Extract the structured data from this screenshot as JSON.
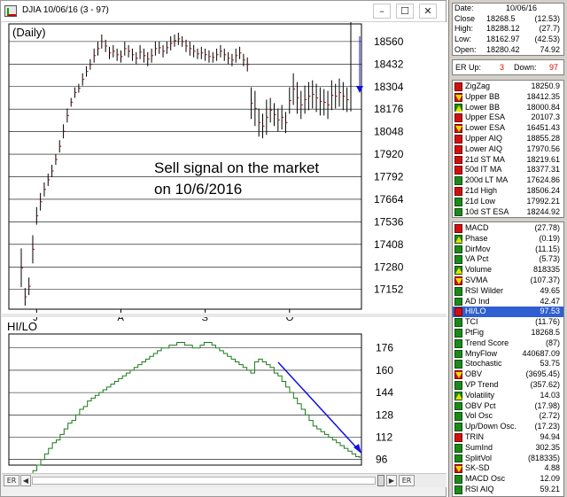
{
  "window": {
    "title": "DJIA 10/06/16 (3 - 97)",
    "minimize": "–",
    "maximize": "☐",
    "close": "✕"
  },
  "price_chart": {
    "period_label": "(Daily)",
    "annotation_line1": "Sell signal on the market",
    "annotation_line2": "on 10/6/2016",
    "y_ticks": [
      "18560",
      "18432",
      "18304",
      "18176",
      "18048",
      "17920",
      "17792",
      "17664",
      "17536",
      "17408",
      "17280",
      "17152"
    ],
    "x_ticks": [
      "J",
      "A",
      "S",
      "O"
    ],
    "bars": [
      [
        17385,
        17165
      ],
      [
        17160,
        17060
      ],
      [
        17220,
        17120
      ],
      [
        17460,
        17300
      ],
      [
        17620,
        17520
      ],
      [
        17700,
        17600
      ],
      [
        17760,
        17680
      ],
      [
        17810,
        17740
      ],
      [
        17860,
        17790
      ],
      [
        17920,
        17860
      ],
      [
        18000,
        17930
      ],
      [
        18090,
        18010
      ],
      [
        18180,
        18100
      ],
      [
        18240,
        18190
      ],
      [
        18300,
        18240
      ],
      [
        18320,
        18270
      ],
      [
        18380,
        18310
      ],
      [
        18420,
        18360
      ],
      [
        18460,
        18400
      ],
      [
        18520,
        18440
      ],
      [
        18560,
        18480
      ],
      [
        18600,
        18520
      ],
      [
        18570,
        18500
      ],
      [
        18530,
        18460
      ],
      [
        18540,
        18470
      ],
      [
        18520,
        18450
      ],
      [
        18510,
        18440
      ],
      [
        18560,
        18480
      ],
      [
        18540,
        18470
      ],
      [
        18520,
        18450
      ],
      [
        18500,
        18430
      ],
      [
        18540,
        18460
      ],
      [
        18520,
        18440
      ],
      [
        18500,
        18420
      ],
      [
        18520,
        18440
      ],
      [
        18560,
        18480
      ],
      [
        18560,
        18490
      ],
      [
        18540,
        18470
      ],
      [
        18560,
        18490
      ],
      [
        18590,
        18510
      ],
      [
        18600,
        18530
      ],
      [
        18610,
        18540
      ],
      [
        18590,
        18530
      ],
      [
        18570,
        18500
      ],
      [
        18560,
        18480
      ],
      [
        18540,
        18470
      ],
      [
        18520,
        18460
      ],
      [
        18530,
        18460
      ],
      [
        18520,
        18450
      ],
      [
        18510,
        18440
      ],
      [
        18500,
        18440
      ],
      [
        18520,
        18450
      ],
      [
        18540,
        18470
      ],
      [
        18520,
        18450
      ],
      [
        18500,
        18430
      ],
      [
        18490,
        18420
      ],
      [
        18520,
        18440
      ],
      [
        18530,
        18460
      ],
      [
        18490,
        18420
      ],
      [
        18470,
        18390
      ],
      [
        18300,
        18120
      ],
      [
        18280,
        18080
      ],
      [
        18180,
        18020
      ],
      [
        18150,
        18010
      ],
      [
        18230,
        18030
      ],
      [
        18240,
        18100
      ],
      [
        18210,
        18080
      ],
      [
        18180,
        18050
      ],
      [
        18200,
        18060
      ],
      [
        18160,
        18040
      ],
      [
        18300,
        18150
      ],
      [
        18380,
        18200
      ],
      [
        18330,
        18150
      ],
      [
        18280,
        18120
      ],
      [
        18310,
        18150
      ],
      [
        18330,
        18170
      ],
      [
        18340,
        18180
      ],
      [
        18320,
        18160
      ],
      [
        18300,
        18140
      ],
      [
        18290,
        18140
      ],
      [
        18280,
        18120
      ],
      [
        18340,
        18170
      ],
      [
        18320,
        18180
      ],
      [
        18350,
        18190
      ],
      [
        18330,
        18170
      ],
      [
        18300,
        18160
      ]
    ],
    "signal_bar": [
      18680,
      18163
    ],
    "annotation_color": "#0000ff"
  },
  "hilo_chart": {
    "title": "HI/LO",
    "y_ticks": [
      "176",
      "160",
      "144",
      "128",
      "112",
      "96"
    ],
    "series": [
      84,
      84,
      86,
      88,
      92,
      96,
      100,
      104,
      108,
      110,
      114,
      118,
      122,
      124,
      128,
      132,
      134,
      138,
      140,
      142,
      144,
      146,
      148,
      150,
      152,
      154,
      156,
      158,
      160,
      162,
      164,
      166,
      168,
      170,
      172,
      174,
      176,
      176,
      178,
      178,
      180,
      180,
      178,
      178,
      176,
      176,
      178,
      180,
      180,
      178,
      176,
      174,
      172,
      170,
      168,
      166,
      164,
      162,
      160,
      158,
      166,
      168,
      166,
      164,
      162,
      158,
      156,
      152,
      148,
      144,
      140,
      136,
      132,
      128,
      124,
      120,
      118,
      116,
      114,
      112,
      110,
      108,
      106,
      104,
      102,
      100,
      98,
      97
    ],
    "arrow_color": "#1010e0"
  },
  "scrollbar": {
    "left_label": "ER",
    "right_label": "ER"
  },
  "info": {
    "date_label": "Date:",
    "date": "10/06/16",
    "close_label": "Close",
    "close": "18268.5",
    "close_chg": "(12.53)",
    "high_label": "High:",
    "high": "18288.12",
    "high_chg": "(27.7)",
    "low_label": "Low:",
    "low": "18162.97",
    "low_chg": "(42.53)",
    "open_label": "Open:",
    "open": "18280.42",
    "open_chg": "74.92"
  },
  "er": {
    "up_label": "ER Up:",
    "up": "3",
    "down_label": "Down:",
    "down": "97"
  },
  "overlays": [
    {
      "label": "ZigZag",
      "value": "18250.9",
      "icon": "red"
    },
    {
      "label": "Upper BB",
      "value": "18412.35",
      "icon": "down"
    },
    {
      "label": "Lower BB",
      "value": "18000.84",
      "icon": "up"
    },
    {
      "label": "Upper ESA",
      "value": "20107.3",
      "icon": "red"
    },
    {
      "label": "Lower ESA",
      "value": "16451.43",
      "icon": "down"
    },
    {
      "label": "Upper AIQ",
      "value": "18855.28",
      "icon": "red"
    },
    {
      "label": "Lower AIQ",
      "value": "17970.56",
      "icon": "red"
    },
    {
      "label": "21d ST MA",
      "value": "18219.61",
      "icon": "red"
    },
    {
      "label": "50d IT MA",
      "value": "18377.31",
      "icon": "red"
    },
    {
      "label": "200d LT MA",
      "value": "17624.86",
      "icon": "green"
    },
    {
      "label": "21d High",
      "value": "18506.24",
      "icon": "red"
    },
    {
      "label": "21d Low",
      "value": "17992.21",
      "icon": "green"
    },
    {
      "label": "10d ST ESA",
      "value": "18244.92",
      "icon": "green"
    }
  ],
  "indicators": [
    {
      "label": "MACD",
      "value": "(27.78)",
      "icon": "red"
    },
    {
      "label": "Phase",
      "value": "(0.19)",
      "icon": "up"
    },
    {
      "label": "DirMov",
      "value": "(11.15)",
      "icon": "green"
    },
    {
      "label": "VA Pct",
      "value": "(5.73)",
      "icon": "green"
    },
    {
      "label": "Volume",
      "value": "818335",
      "icon": "up"
    },
    {
      "label": "SVMA",
      "value": "(107.37)",
      "icon": "down"
    },
    {
      "label": "RSI Wilder",
      "value": "49.65",
      "icon": "green"
    },
    {
      "label": "AD Ind",
      "value": "42.47",
      "icon": "green"
    },
    {
      "label": "HI/LO",
      "value": "97.53",
      "icon": "red",
      "selected": true
    },
    {
      "label": "TCI",
      "value": "(11.76)",
      "icon": "green"
    },
    {
      "label": "PtFig",
      "value": "18268.5",
      "icon": "green"
    },
    {
      "label": "Trend Score",
      "value": "(87)",
      "icon": "green"
    },
    {
      "label": "MnyFlow",
      "value": "440687.09",
      "icon": "green"
    },
    {
      "label": "Stochastic",
      "value": "53.75",
      "icon": "green"
    },
    {
      "label": "OBV",
      "value": "(3695.45)",
      "icon": "down"
    },
    {
      "label": "VP Trend",
      "value": "(357.62)",
      "icon": "green"
    },
    {
      "label": "Volatility",
      "value": "14.03",
      "icon": "up"
    },
    {
      "label": "OBV Pct",
      "value": "(17.98)",
      "icon": "green"
    },
    {
      "label": "Vol Osc",
      "value": "(2.72)",
      "icon": "green"
    },
    {
      "label": "Up/Down Osc.",
      "value": "(17.23)",
      "icon": "green"
    },
    {
      "label": "TRIN",
      "value": "94.94",
      "icon": "red"
    },
    {
      "label": "SumInd",
      "value": "302.35",
      "icon": "green"
    },
    {
      "label": "SplitVol",
      "value": "(818335)",
      "icon": "green"
    },
    {
      "label": "SK-SD",
      "value": "4.88",
      "icon": "down"
    },
    {
      "label": "MACD Osc",
      "value": "12.09",
      "icon": "green"
    },
    {
      "label": "RSI AIQ",
      "value": "59.21",
      "icon": "green"
    }
  ]
}
